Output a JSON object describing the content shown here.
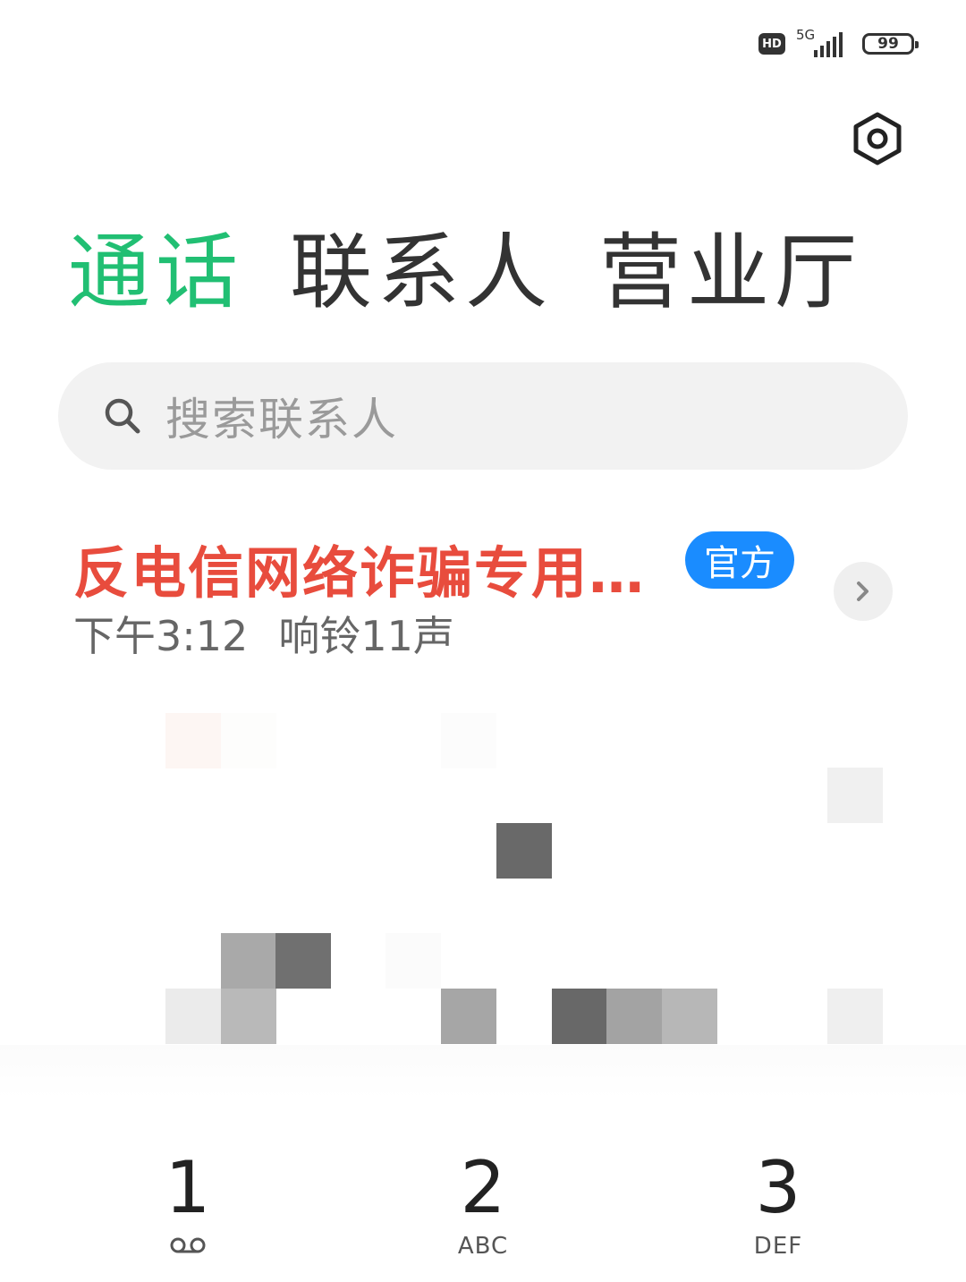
{
  "status_bar": {
    "hd": "HD",
    "network": "5G",
    "battery": "99"
  },
  "tabs": [
    {
      "label": "通话",
      "active": true
    },
    {
      "label": "联系人",
      "active": false
    },
    {
      "label": "营业厅",
      "active": false
    }
  ],
  "search": {
    "placeholder": "搜索联系人"
  },
  "call_log": [
    {
      "name": "反电信网络诈骗专用…",
      "badge": "官方",
      "time": "下午3:12",
      "status": "响铃11声"
    }
  ],
  "dialpad": {
    "keys": [
      {
        "digit": "1",
        "letters": "",
        "icon": "voicemail-icon"
      },
      {
        "digit": "2",
        "letters": "ABC"
      },
      {
        "digit": "3",
        "letters": "DEF"
      }
    ]
  },
  "colors": {
    "accent_green": "#21bf73",
    "caller_red": "#e84c3d",
    "badge_blue": "#1a8cff"
  }
}
